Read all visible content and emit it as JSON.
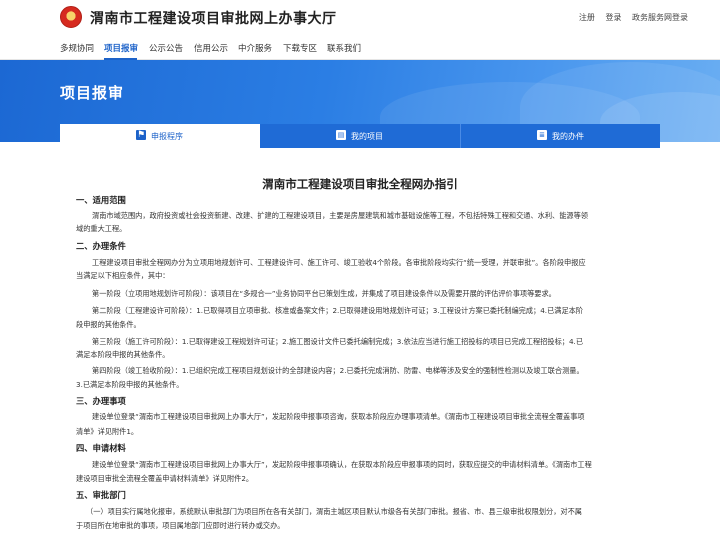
{
  "header": {
    "site_title": "渭南市工程建设项目审批网上办事大厅",
    "links": [
      "注册",
      "登录",
      "政务服务网登录"
    ]
  },
  "nav": {
    "items": [
      "多规协同",
      "项目报审",
      "公示公告",
      "信用公示",
      "中介服务",
      "下载专区",
      "联系我们"
    ],
    "active": "项目报审"
  },
  "banner": {
    "title": "项目报审"
  },
  "tabs": [
    {
      "label": "申报程序",
      "icon": "flag-icon"
    },
    {
      "label": "我的项目",
      "icon": "id-card-icon"
    },
    {
      "label": "我的办件",
      "icon": "document-icon"
    }
  ],
  "colors": {
    "primary": "#1c62c9",
    "tab_bg": "#1f6bd6",
    "banner": "#2b7ee4"
  },
  "document": {
    "title": "渭南市工程建设项目审批全程网办指引",
    "s1_heading": "一、适用范围",
    "s1_p1_l1": "渭南市域范围内，政府投资或社会投资新建、改建、扩建的工程建设项目，主要是房屋建筑和城市基础设施等工程，不包括特殊工程和交通、水利、能源等领",
    "s1_p1_l2": "域的重大工程。",
    "s2_heading": "二、办理条件",
    "s2_p1_l1": "工程建设项目审批全程网办分为立项用地规划许可、工程建设许可、施工许可、竣工验收4个阶段。各审批阶段均实行“统一受理，并联审批”。各阶段申报应",
    "s2_p1_l2": "当满足以下相应条件，其中：",
    "s2_p2": "第一阶段（立项用地规划许可阶段）：该项目在“多规合一”业务协同平台已策划生成，并集成了项目建设条件以及需要开展的评估评价事项等要求。",
    "s2_p3_l1": "第二阶段（工程建设许可阶段）：1.已取得项目立项审批、核准或备案文件；2.已取得建设用地规划许可证；3.工程设计方案已委托制编完成；4.已满足本阶",
    "s2_p3_l2": "段申报的其他条件。",
    "s2_p4_l1": "第三阶段（施工许可阶段）：1.已取得建设工程规划许可证；2.施工图设计文件已委托编制完成；3.依法应当进行施工招投标的项目已完成工程招投标；4.已",
    "s2_p4_l2": "满足本阶段申报的其他条件。",
    "s2_p5_l1": "第四阶段（竣工验收阶段）：1.已组织完成工程项目规划设计的全部建设内容；2.已委托完成消防、防雷、电梯等涉及安全的强制性检测以及竣工联合测量。",
    "s2_p5_l2": "3.已满足本阶段申报的其他条件。",
    "s3_heading": "三、办理事项",
    "s3_p1_l1": "建设单位登录“渭南市工程建设项目审批网上办事大厅”，发起阶段申报事项咨询，获取本阶段应办理事项清单。《渭南市工程建设项目审批全流程全覆盖事项",
    "s3_p1_l2": "清单》详见附件1。",
    "s4_heading": "四、申请材料",
    "s4_p1_l1": "建设单位登录“渭南市工程建设项目审批网上办事大厅”，发起阶段申报事项确认，在获取本阶段应申报事项的同时，获取应提交的申请材料清单。《渭南市工程",
    "s4_p1_l2": "建设项目审批全流程全覆盖申请材料清单》详见附件2。",
    "s5_heading": "五、审批部门",
    "s5_p1_l1": "（一）项目实行属地化报审，系统默认审批部门为项目所在各有关部门，渭南主城区项目默认市级各有关部门审批。报省、市、县三级审批权限划分，对不属",
    "s5_p1_l2": "于项目所在地审批的事项，项目属地部门应即时进行转办或交办。"
  }
}
